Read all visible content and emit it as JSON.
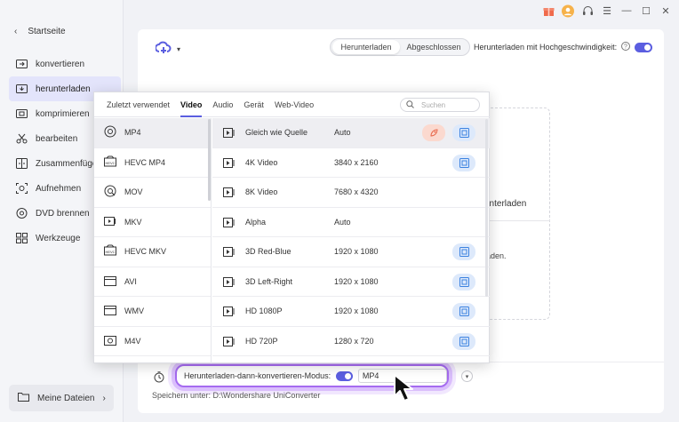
{
  "sidebar": {
    "home_label": "Startseite",
    "items": [
      {
        "label": "konvertieren",
        "icon": "convert-icon"
      },
      {
        "label": "herunterladen",
        "icon": "download-icon",
        "active": true
      },
      {
        "label": "komprimieren",
        "icon": "compress-icon"
      },
      {
        "label": "bearbeiten",
        "icon": "scissors-icon"
      },
      {
        "label": "Zusammenfügen",
        "icon": "merge-icon"
      },
      {
        "label": "Aufnehmen",
        "icon": "record-icon"
      },
      {
        "label": "DVD brennen",
        "icon": "disc-icon"
      },
      {
        "label": "Werkzeuge",
        "icon": "grid-icon"
      }
    ],
    "my_files_label": "Meine Dateien"
  },
  "header": {
    "tabs": [
      "Herunterladen",
      "Abgeschlossen"
    ],
    "high_speed_label": "Herunterladen mit Hochgeschwindigkeit:",
    "high_speed_on": true
  },
  "dropzone": {
    "text1": "unterladen",
    "text2": "laden."
  },
  "format_popup": {
    "tabs": [
      "Zuletzt verwendet",
      "Video",
      "Audio",
      "Gerät",
      "Web-Video"
    ],
    "active_tab": "Video",
    "search_placeholder": "Suchen",
    "formats": [
      {
        "label": "MP4",
        "icon": "mp4-icon"
      },
      {
        "label": "HEVC MP4",
        "icon": "hevc-icon"
      },
      {
        "label": "MOV",
        "icon": "mov-icon"
      },
      {
        "label": "MKV",
        "icon": "mkv-icon"
      },
      {
        "label": "HEVC MKV",
        "icon": "hevc-icon"
      },
      {
        "label": "AVI",
        "icon": "avi-icon"
      },
      {
        "label": "WMV",
        "icon": "wmv-icon"
      },
      {
        "label": "M4V",
        "icon": "m4v-icon"
      }
    ],
    "resolutions": [
      {
        "name": "Gleich wie Quelle",
        "value": "Auto"
      },
      {
        "name": "4K Video",
        "value": "3840 x 2160"
      },
      {
        "name": "8K Video",
        "value": "7680 x 4320"
      },
      {
        "name": "Alpha",
        "value": "Auto"
      },
      {
        "name": "3D Red-Blue",
        "value": "1920 x 1080"
      },
      {
        "name": "3D Left-Right",
        "value": "1920 x 1080"
      },
      {
        "name": "HD 1080P",
        "value": "1920 x 1080"
      },
      {
        "name": "HD 720P",
        "value": "1280 x 720"
      }
    ]
  },
  "bottom": {
    "mode_label": "Herunterladen-dann-konvertieren-Modus:",
    "mode_on": true,
    "mode_format": "MP4",
    "save_to": "Speichern unter:  D:\\Wondershare UniConverter"
  },
  "colors": {
    "accent": "#5b5ee0",
    "highlight": "#a56bf0",
    "edit_btn": "#dde9fb",
    "boost_btn": "#fbd9cf"
  }
}
